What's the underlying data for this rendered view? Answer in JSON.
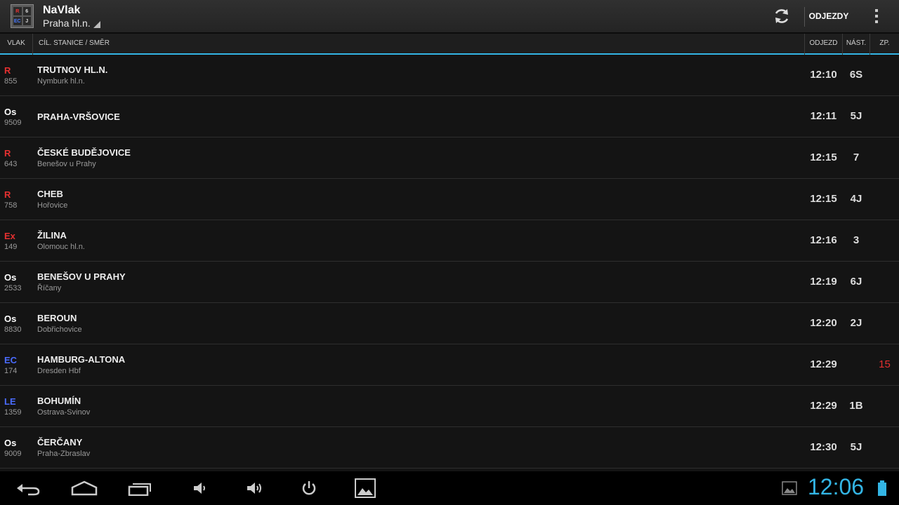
{
  "app": {
    "title": "NaVlak",
    "station": "Praha hl.n.",
    "icon_letters": [
      "R",
      "6",
      "EC",
      "J"
    ]
  },
  "toolbar": {
    "refresh_icon": "refresh-icon",
    "mode_label": "ODJEZDY",
    "overflow_icon": "overflow-menu-icon"
  },
  "columns": {
    "train": "VLAK",
    "destination": "CÍL. STANICE / SMĚR",
    "departure": "ODJEZD",
    "platform": "NÁST.",
    "delay": "ZP."
  },
  "colors": {
    "accent": "#33b5e5",
    "red": "#e53030",
    "blue": "#4a6cff",
    "white": "#ffffff"
  },
  "departures": [
    {
      "type": "R",
      "type_color": "red",
      "number": "855",
      "destination": "TRUTNOV HL.N.",
      "via": "Nymburk hl.n.",
      "time": "12:10",
      "platform": "6S",
      "delay": ""
    },
    {
      "type": "Os",
      "type_color": "white",
      "number": "9509",
      "destination": "PRAHA-VRŠOVICE",
      "via": "",
      "time": "12:11",
      "platform": "5J",
      "delay": ""
    },
    {
      "type": "R",
      "type_color": "red",
      "number": "643",
      "destination": "ČESKÉ BUDĚJOVICE",
      "via": "Benešov u Prahy",
      "time": "12:15",
      "platform": "7",
      "delay": ""
    },
    {
      "type": "R",
      "type_color": "red",
      "number": "758",
      "destination": "CHEB",
      "via": "Hořovice",
      "time": "12:15",
      "platform": "4J",
      "delay": ""
    },
    {
      "type": "Ex",
      "type_color": "red",
      "number": "149",
      "destination": "ŽILINA",
      "via": "Olomouc hl.n.",
      "time": "12:16",
      "platform": "3",
      "delay": ""
    },
    {
      "type": "Os",
      "type_color": "white",
      "number": "2533",
      "destination": "BENEŠOV U PRAHY",
      "via": "Říčany",
      "time": "12:19",
      "platform": "6J",
      "delay": ""
    },
    {
      "type": "Os",
      "type_color": "white",
      "number": "8830",
      "destination": "BEROUN",
      "via": "Dobřichovice",
      "time": "12:20",
      "platform": "2J",
      "delay": ""
    },
    {
      "type": "EC",
      "type_color": "blue",
      "number": "174",
      "destination": "HAMBURG-ALTONA",
      "via": "Dresden Hbf",
      "time": "12:29",
      "platform": "",
      "delay": "15"
    },
    {
      "type": "LE",
      "type_color": "blue",
      "number": "1359",
      "destination": "BOHUMÍN",
      "via": "Ostrava-Svinov",
      "time": "12:29",
      "platform": "1B",
      "delay": ""
    },
    {
      "type": "Os",
      "type_color": "white",
      "number": "9009",
      "destination": "ČERČANY",
      "via": "Praha-Zbraslav",
      "time": "12:30",
      "platform": "5J",
      "delay": ""
    }
  ],
  "system_bar": {
    "clock": "12:06",
    "icons": [
      "back-icon",
      "home-icon",
      "recent-apps-icon",
      "volume-down-icon",
      "volume-up-icon",
      "power-icon",
      "screenshot-icon",
      "gallery-notification-icon",
      "battery-icon"
    ]
  }
}
